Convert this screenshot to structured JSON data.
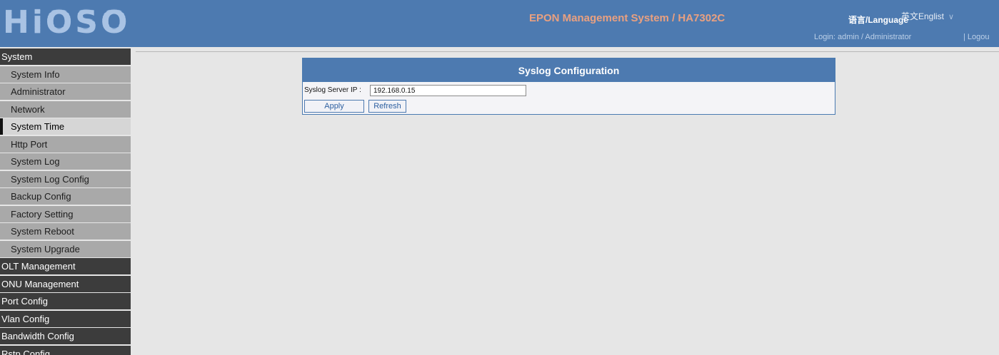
{
  "header": {
    "logo": "HiOSO",
    "title": "EPON Management System / HA7302C",
    "language_label": "语言/Language",
    "language_value": "英文Englist",
    "login_info": "Login: admin / Administrator",
    "logout": "| Logou"
  },
  "sidebar": {
    "items": [
      {
        "label": "System",
        "level": "top"
      },
      {
        "label": "System Info",
        "level": "sub"
      },
      {
        "label": "Administrator",
        "level": "sub"
      },
      {
        "label": "Network",
        "level": "sub"
      },
      {
        "label": "System Time",
        "level": "sub",
        "active": true
      },
      {
        "label": "Http Port",
        "level": "sub"
      },
      {
        "label": "System Log",
        "level": "sub"
      },
      {
        "label": "System Log Config",
        "level": "sub"
      },
      {
        "label": "Backup Config",
        "level": "sub"
      },
      {
        "label": "Factory Setting",
        "level": "sub"
      },
      {
        "label": "System Reboot",
        "level": "sub"
      },
      {
        "label": "System Upgrade",
        "level": "sub"
      },
      {
        "label": "OLT Management",
        "level": "top"
      },
      {
        "label": "ONU Management",
        "level": "top"
      },
      {
        "label": "Port Config",
        "level": "top"
      },
      {
        "label": "Vlan Config",
        "level": "top"
      },
      {
        "label": "Bandwidth Config",
        "level": "top"
      },
      {
        "label": "Rstp Config",
        "level": "top"
      }
    ]
  },
  "panel": {
    "title": "Syslog Configuration",
    "field_label": "Syslog Server IP :",
    "field_value": "192.168.0.15",
    "apply_label": "Apply",
    "refresh_label": "Refresh"
  },
  "colors": {
    "header_bg": "#4d7ab0",
    "title_accent": "#e9a080",
    "sidebar_top_bg": "#3c3c3c",
    "sidebar_sub_bg": "#a9a9a9",
    "sidebar_active_bg": "#d6d6d6",
    "content_bg": "#e6e6e6"
  },
  "icons": {
    "language_dropdown": "chevron-down-icon"
  }
}
